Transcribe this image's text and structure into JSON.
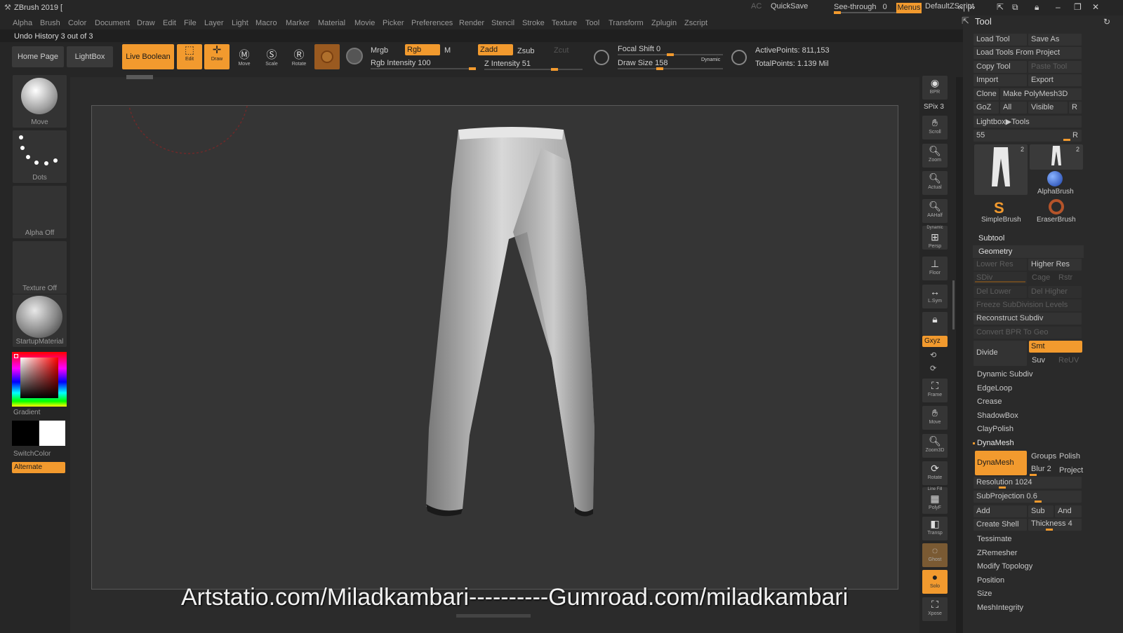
{
  "title": {
    "app_name": "ZBrush 2019 [",
    "ac": "AC",
    "quicksave": "QuickSave",
    "see_through": "See-through",
    "see_through_value": "0",
    "menus": "Menus",
    "default_script": "DefaultZScript"
  },
  "menu": [
    "Alpha",
    "Brush",
    "Color",
    "Document",
    "Draw",
    "Edit",
    "File",
    "Layer",
    "Light",
    "Macro",
    "Marker",
    "Material",
    "Movie",
    "Picker",
    "Preferences",
    "Render",
    "Stencil",
    "Stroke",
    "Texture",
    "Tool",
    "Transform",
    "Zplugin",
    "Zscript"
  ],
  "undo_history": "Undo History 3 out of 3",
  "shelf": {
    "home_page": "Home Page",
    "lightbox": "LightBox",
    "live_boolean": "Live Boolean",
    "edit": "Edit",
    "draw": "Draw",
    "move": "Move",
    "scale": "Scale",
    "rotate": "Rotate",
    "mrgb": "Mrgb",
    "rgb": "Rgb",
    "m": "M",
    "rgb_intensity": "Rgb Intensity 100",
    "zadd": "Zadd",
    "zsub": "Zsub",
    "zcut": "Zcut",
    "z_intensity": "Z Intensity 51",
    "focal_shift": "Focal Shift 0",
    "draw_size": "Draw Size 158",
    "dynamic": "Dynamic",
    "active_points": "ActivePoints: 811,153",
    "total_points": "TotalPoints: 1.139 Mil"
  },
  "left": {
    "move": "Move",
    "dots": "Dots",
    "alpha_off": "Alpha Off",
    "texture_off": "Texture Off",
    "startup_material": "StartupMaterial",
    "gradient": "Gradient",
    "switch_color": "SwitchColor",
    "alternate": "Alternate"
  },
  "right_strip": {
    "bpr": "BPR",
    "spix": "SPix 3",
    "scroll": "Scroll",
    "zoom": "Zoom",
    "actual": "Actual",
    "aahalf": "AAHalf",
    "dynamic": "Dynamic",
    "persp": "Persp",
    "floor": "Floor",
    "lsym": "L.Sym",
    "xyz": "Gxyz",
    "frame": "Frame",
    "move": "Move",
    "zoom3d": "Zoom3D",
    "rotate": "Rotate",
    "linefill": "Line Fill",
    "polyf": "PolyF",
    "transp": "Transp",
    "ghost": "Ghost",
    "solo": "Solo",
    "xpose": "Xpose"
  },
  "tool_panel": {
    "title": "Tool",
    "load_tool": "Load Tool",
    "save_as": "Save As",
    "load_from_project": "Load Tools From Project",
    "copy_tool": "Copy Tool",
    "paste_tool": "Paste Tool",
    "import": "Import",
    "export": "Export",
    "clone": "Clone",
    "make_polymesh": "Make PolyMesh3D",
    "goz": "GoZ",
    "all": "All",
    "visible": "Visible",
    "r": "R",
    "lightbox_tools": "Lightbox▶Tools",
    "slider_value": "55",
    "thumb_count_1": "2",
    "thumb_count_2": "2",
    "alpha_brush": "AlphaBrush",
    "simple_brush": "SimpleBrush",
    "eraser_brush": "EraserBrush",
    "subtool": "Subtool",
    "geometry": "Geometry",
    "lower_res": "Lower Res",
    "higher_res": "Higher Res",
    "sdiv": "SDiv",
    "cage": "Cage",
    "rstr": "Rstr",
    "del_lower": "Del Lower",
    "del_higher": "Del Higher",
    "freeze_subdiv": "Freeze SubDivision Levels",
    "reconstruct_subdiv": "Reconstruct Subdiv",
    "convert_bpr": "Convert BPR To Geo",
    "divide": "Divide",
    "smt": "Smt",
    "suv": "Suv",
    "reuv": "ReUV",
    "dynamic_subdiv": "Dynamic Subdiv",
    "edgeloop": "EdgeLoop",
    "crease": "Crease",
    "shadowbox": "ShadowBox",
    "claypolish": "ClayPolish",
    "dynamesh_hdr": "DynaMesh",
    "dynamesh": "DynaMesh",
    "groups": "Groups",
    "polish": "Polish",
    "blur": "Blur 2",
    "project": "Project",
    "resolution": "Resolution 1024",
    "subprojection": "SubProjection 0.6",
    "add": "Add",
    "sub": "Sub",
    "and": "And",
    "create_shell": "Create Shell",
    "thickness": "Thickness 4",
    "tessimate": "Tessimate",
    "zremesher": "ZRemesher",
    "modify_topology": "Modify Topology",
    "position": "Position",
    "size": "Size",
    "meshintegrity": "MeshIntegrity"
  },
  "watermark": "Artstatio.com/Miladkambari----------Gumroad.com/miladkambari",
  "colors": {
    "accent": "#f29a2e",
    "panel": "#262626",
    "canvas": "#353535"
  }
}
